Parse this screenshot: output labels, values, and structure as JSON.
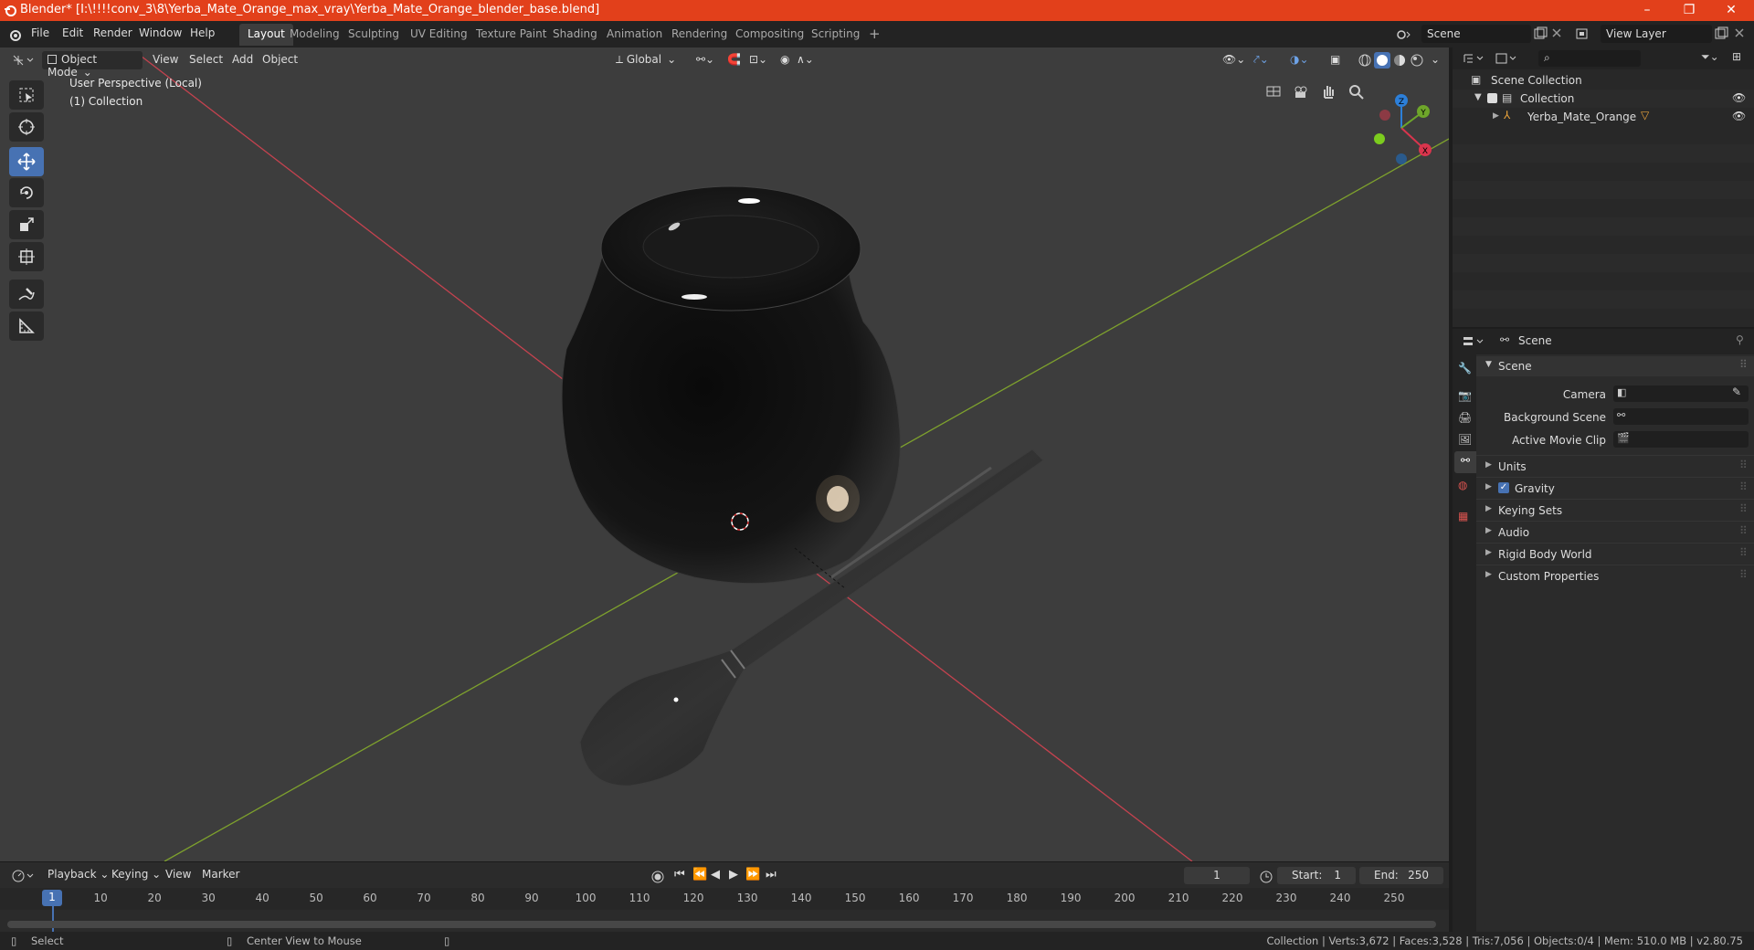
{
  "window": {
    "title": "Blender* [I:\\!!!!conv_3\\8\\Yerba_Mate_Orange_max_vray\\Yerba_Mate_Orange_blender_base.blend]",
    "minimize": "–",
    "restore": "❐",
    "close": "✕"
  },
  "topbar": {
    "menus": [
      "File",
      "Edit",
      "Render",
      "Window",
      "Help"
    ],
    "workspaces": [
      "Layout",
      "Modeling",
      "Sculpting",
      "UV Editing",
      "Texture Paint",
      "Shading",
      "Animation",
      "Rendering",
      "Compositing",
      "Scripting"
    ],
    "active_workspace": "Layout",
    "add_tab": "+",
    "scene_label": "Scene",
    "view_layer_label": "View Layer"
  },
  "viewport": {
    "mode": "Object Mode",
    "menus": [
      "View",
      "Select",
      "Add",
      "Object"
    ],
    "orientation": "Global",
    "perspective_label": "User Perspective (Local)",
    "collection_label": "(1) Collection",
    "gizmo": {
      "z": "Z",
      "y": "Y",
      "x": "X"
    }
  },
  "timeline": {
    "menus": [
      "Playback",
      "Keying",
      "View",
      "Marker"
    ],
    "current_frame": "1",
    "start_label": "Start:",
    "start_value": "1",
    "end_label": "End:",
    "end_value": "250",
    "ticks": [
      "1",
      "10",
      "20",
      "30",
      "40",
      "50",
      "60",
      "70",
      "80",
      "90",
      "100",
      "110",
      "120",
      "130",
      "140",
      "150",
      "160",
      "170",
      "180",
      "190",
      "200",
      "210",
      "220",
      "230",
      "240",
      "250"
    ]
  },
  "statusbar": {
    "select": "Select",
    "center_view": "Center View to Mouse",
    "stats": "Collection | Verts:3,672 | Faces:3,528 | Tris:7,056 | Objects:0/4 | Mem: 510.0 MB | v2.80.75"
  },
  "outliner": {
    "root": "Scene Collection",
    "collection": "Collection",
    "object": "Yerba_Mate_Orange"
  },
  "properties": {
    "header": "Scene",
    "section": "Scene",
    "camera_label": "Camera",
    "background_label": "Background Scene",
    "movieclip_label": "Active Movie Clip",
    "subsections": [
      "Units",
      "Gravity",
      "Keying Sets",
      "Audio",
      "Rigid Body World",
      "Custom Properties"
    ]
  },
  "colors": {
    "titlebar": "#e2401b",
    "accent": "#4772b3",
    "x_axis": "#c4424f",
    "y_axis": "#7ea12d"
  }
}
